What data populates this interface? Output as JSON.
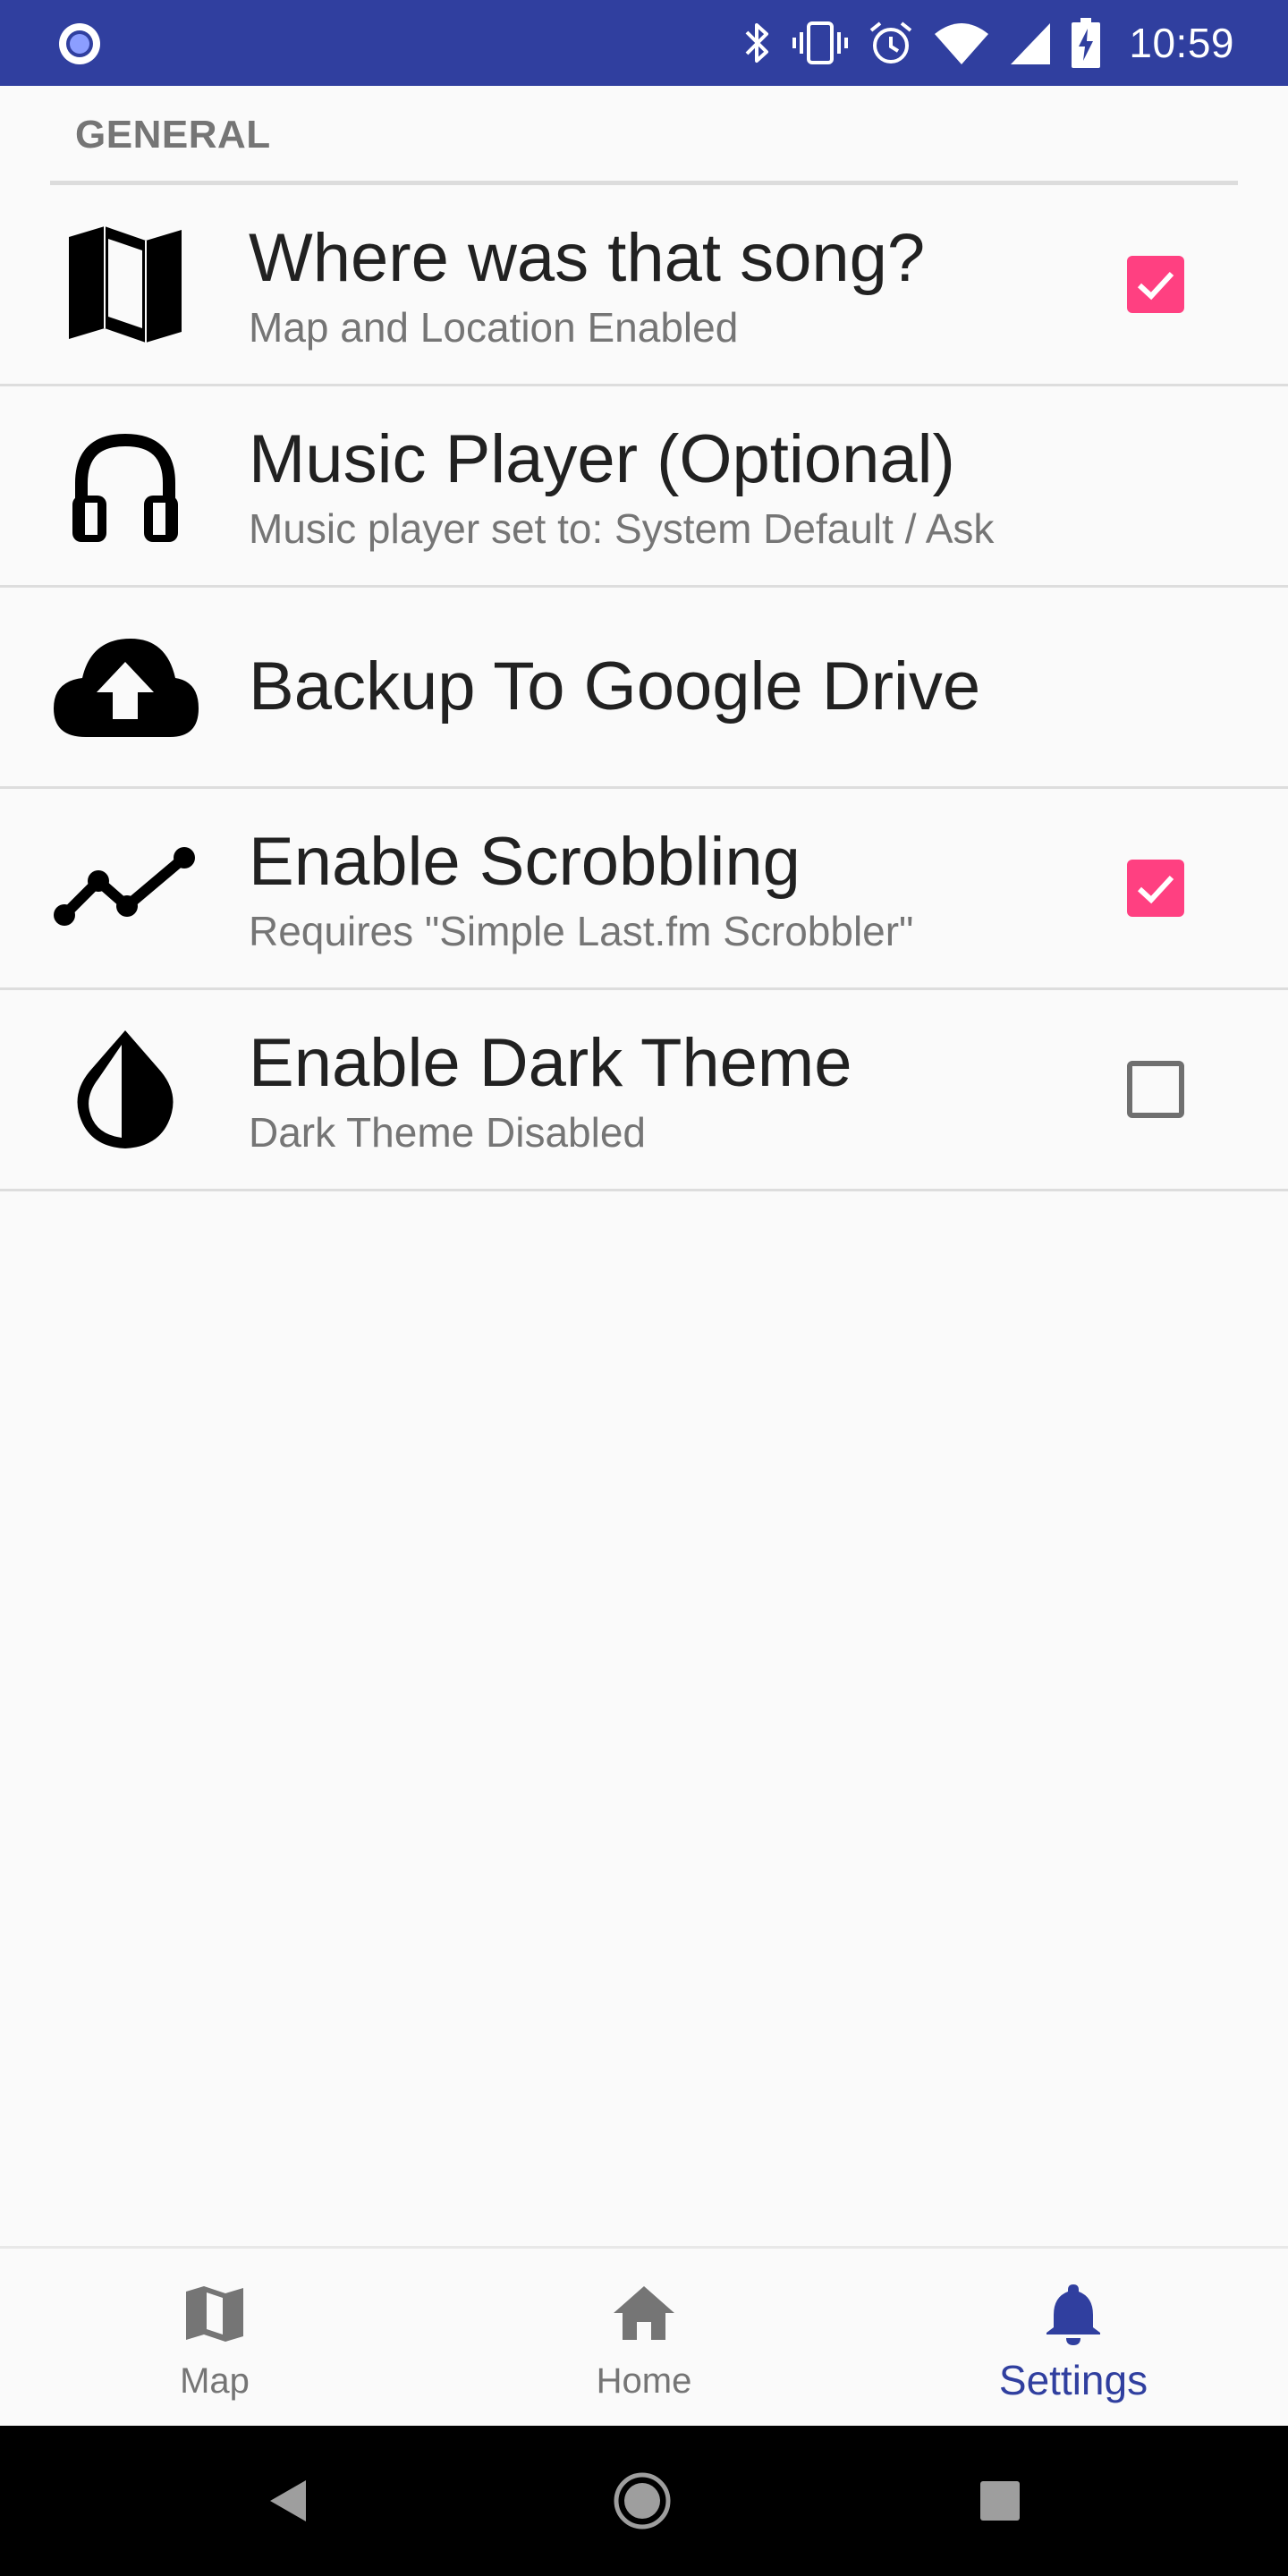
{
  "status_bar": {
    "time": "10:59",
    "background_color": "#303f9f",
    "icons": [
      "app-notification-icon",
      "bluetooth-icon",
      "vibrate-icon",
      "alarm-icon",
      "wifi-icon",
      "signal-icon",
      "battery-charging-icon"
    ]
  },
  "settings": {
    "section_header": "GENERAL",
    "items": [
      {
        "icon": "map-icon",
        "title": "Where was that song?",
        "summary": "Map and Location Enabled",
        "checkbox": "checked"
      },
      {
        "icon": "headphones-icon",
        "title": "Music Player (Optional)",
        "summary": "Music player set to: System Default / Ask",
        "checkbox": "none"
      },
      {
        "icon": "cloud-upload-icon",
        "title": "Backup To Google Drive",
        "summary": "",
        "checkbox": "none"
      },
      {
        "icon": "scrobble-line-icon",
        "title": "Enable Scrobbling",
        "summary": "Requires \"Simple Last.fm Scrobbler\"",
        "checkbox": "checked"
      },
      {
        "icon": "invert-colors-icon",
        "title": "Enable Dark Theme",
        "summary": "Dark Theme Disabled",
        "checkbox": "unchecked"
      }
    ],
    "accent_color": "#ff4081"
  },
  "bottom_nav": {
    "items": [
      {
        "label": "Map",
        "icon": "map-icon",
        "active": false
      },
      {
        "label": "Home",
        "icon": "home-icon",
        "active": false
      },
      {
        "label": "Settings",
        "icon": "bell-icon",
        "active": true
      }
    ],
    "active_color": "#303f9f",
    "inactive_color": "#757575"
  },
  "system_nav": {
    "buttons": [
      "back-icon",
      "home-circle-icon",
      "recents-icon"
    ]
  }
}
